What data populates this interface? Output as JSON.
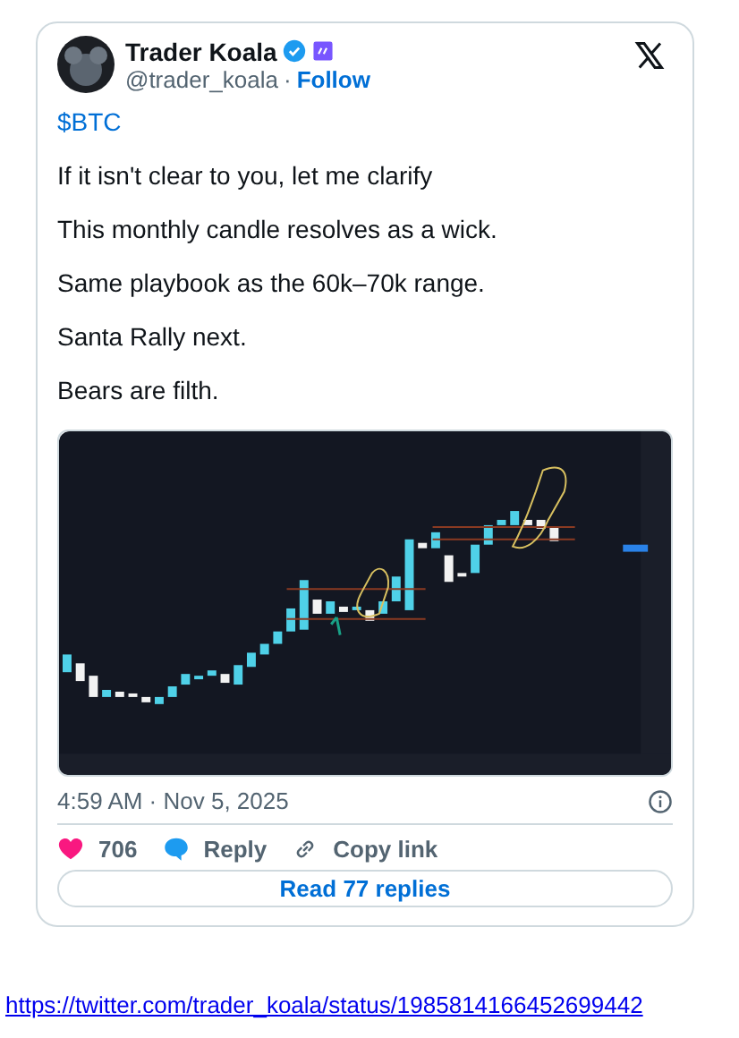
{
  "author": {
    "name": "Trader Koala",
    "handle": "@trader_koala",
    "separator": "·",
    "follow": "Follow",
    "verified": true,
    "affiliate_badge": true
  },
  "paragraphs": [
    {
      "text": "$BTC",
      "kind": "cashtag"
    },
    {
      "text": "If it isn't clear to you, let me clarify",
      "kind": "plain"
    },
    {
      "text": "This monthly candle resolves as a wick.",
      "kind": "plain"
    },
    {
      "text": "Same playbook as the 60k–70k range.",
      "kind": "plain"
    },
    {
      "text": "Santa Rally next.",
      "kind": "plain"
    },
    {
      "text": "Bears are filth.",
      "kind": "plain"
    }
  ],
  "timestamp": "4:59 AM · Nov 5, 2025",
  "actions": [
    {
      "kind": "like",
      "label": "706"
    },
    {
      "kind": "reply",
      "label": "Reply"
    },
    {
      "kind": "copy",
      "label": "Copy link"
    }
  ],
  "read_replies": "Read 77 replies",
  "link": "https://twitter.com/trader_koala/status/1985814166452699442"
}
